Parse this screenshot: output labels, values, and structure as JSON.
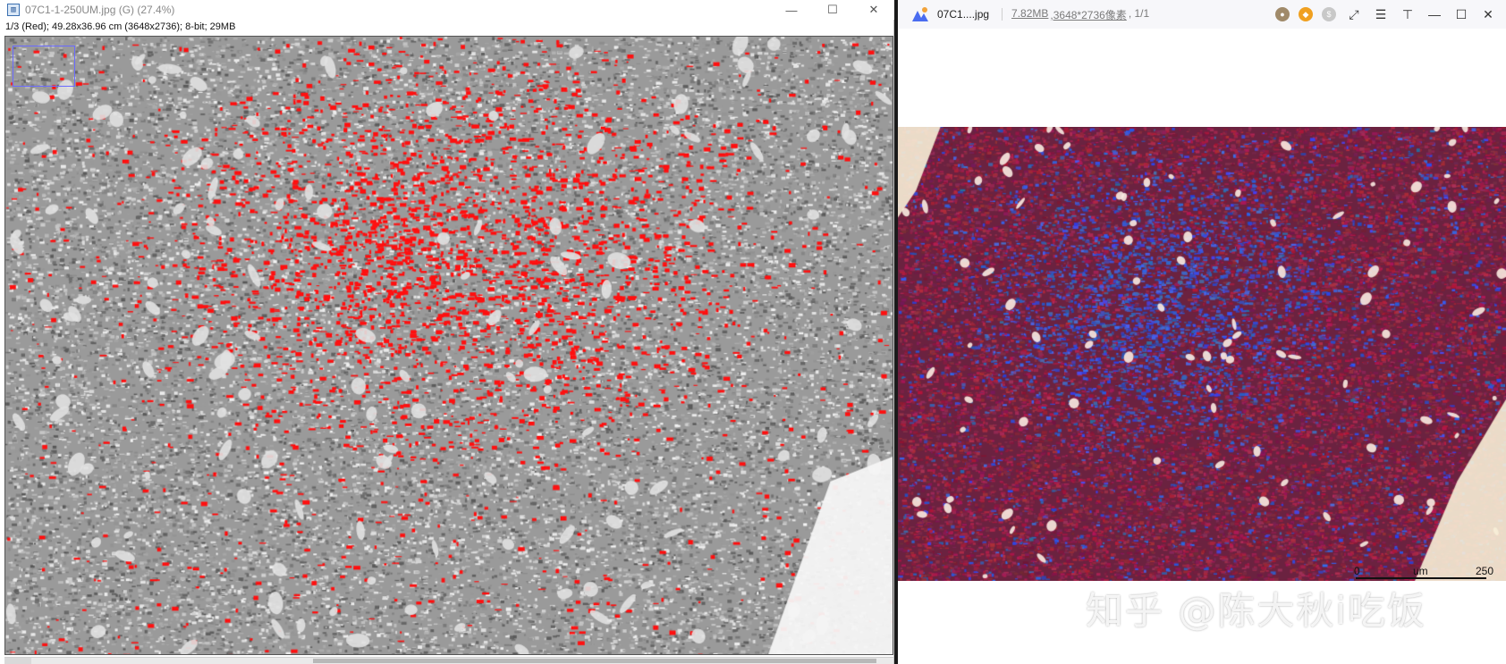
{
  "imagej": {
    "title": "07C1-1-250UM.jpg (G) (27.4%)",
    "info": "1/3 (Red); 49.28x36.96 cm (3648x2736); 8-bit; 29MB",
    "controls": {
      "minimize": "—",
      "maximize": "☐",
      "close": "✕"
    }
  },
  "viewer": {
    "filename": "07C1....jpg",
    "size": "7.82MB",
    "dimensions": ",3648*2736像素",
    "page": ", 1/1",
    "scalebar": {
      "zero": "0",
      "unit": "um",
      "max": "250"
    },
    "watermark": "知乎 @陈大秋i吃饭"
  }
}
